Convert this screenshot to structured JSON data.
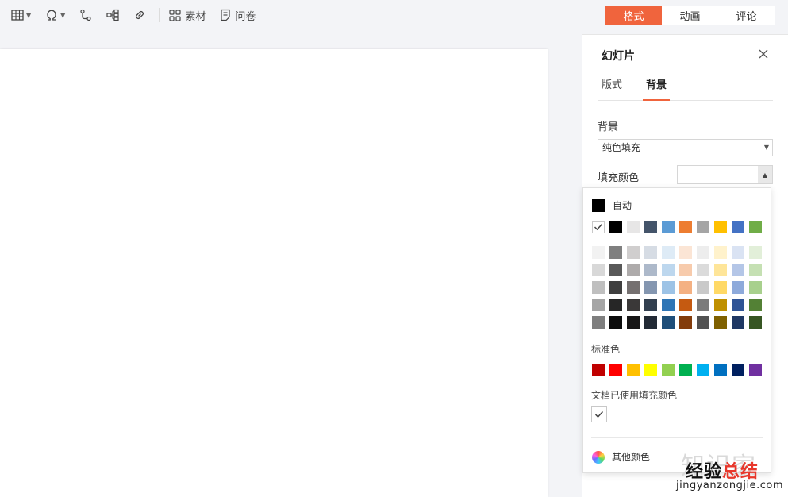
{
  "toolbar": {
    "material_label": "素材",
    "survey_label": "问卷"
  },
  "mode_tabs": [
    {
      "label": "格式",
      "active": true
    },
    {
      "label": "动画",
      "active": false
    },
    {
      "label": "评论",
      "active": false
    }
  ],
  "panel": {
    "title": "幻灯片",
    "tabs": [
      {
        "label": "版式",
        "active": false
      },
      {
        "label": "背景",
        "active": true
      }
    ],
    "background_label": "背景",
    "fill_type_value": "纯色填充",
    "fill_color_label": "填充颜色"
  },
  "popup": {
    "auto_label": "自动",
    "theme_row": [
      "#000000",
      "#e7e6e6",
      "#44546a",
      "#5b9bd5",
      "#ed7d31",
      "#a5a5a5",
      "#ffc000",
      "#4472c4",
      "#70ad47"
    ],
    "shades": [
      [
        "#f2f2f2",
        "#7f7f7f",
        "#d0cece",
        "#d6dce4",
        "#deebf6",
        "#fbe5d5",
        "#ededed",
        "#fff2cc",
        "#dae3f3",
        "#e2efd9"
      ],
      [
        "#d8d8d8",
        "#595959",
        "#aeabab",
        "#adb9ca",
        "#bdd7ee",
        "#f7cbac",
        "#dbdbdb",
        "#fee599",
        "#b4c6e7",
        "#c5e0b3"
      ],
      [
        "#bfbfbf",
        "#3f3f3f",
        "#757070",
        "#8496b0",
        "#9dc3e6",
        "#f4b183",
        "#c9c9c9",
        "#ffd966",
        "#8eaadb",
        "#a8d08d"
      ],
      [
        "#a5a5a5",
        "#262626",
        "#3a3838",
        "#323f4f",
        "#2e75b5",
        "#c55a11",
        "#7b7b7b",
        "#bf9000",
        "#2f5496",
        "#538135"
      ],
      [
        "#7f7f7f",
        "#0c0c0c",
        "#171616",
        "#222a35",
        "#1e4e79",
        "#833c0b",
        "#525252",
        "#7f6000",
        "#1f3864",
        "#375623"
      ]
    ],
    "standard_label": "标准色",
    "standard": [
      "#c00000",
      "#ff0000",
      "#ffc000",
      "#ffff00",
      "#92d050",
      "#00b050",
      "#00b0f0",
      "#0070c0",
      "#002060",
      "#7030a0"
    ],
    "used_label": "文档已使用填充颜色",
    "more_label": "其他颜色"
  },
  "watermark": {
    "faint": "知识家",
    "main_a": "经验",
    "main_b": "总结",
    "url": "jingyanzongjie.com"
  },
  "colors": {
    "accent": "#f0643d"
  }
}
